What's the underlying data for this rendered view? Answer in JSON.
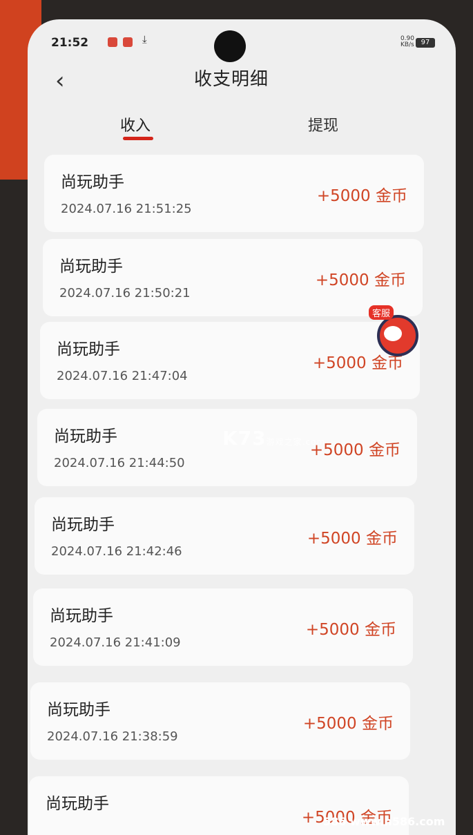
{
  "status_bar": {
    "time": "21:52",
    "network_speed": "0.90",
    "network_unit": "KB/s",
    "battery": "97"
  },
  "header": {
    "back_symbol": "‹",
    "title": "收支明细"
  },
  "tabs": [
    {
      "label": "收入"
    },
    {
      "label": "提现"
    }
  ],
  "records": [
    {
      "name": "尚玩助手",
      "time": "2024.07.16 21:51:25",
      "amount": "+5000 金币"
    },
    {
      "name": "尚玩助手",
      "time": "2024.07.16 21:50:21",
      "amount": "+5000 金币"
    },
    {
      "name": "尚玩助手",
      "time": "2024.07.16 21:47:04",
      "amount": "+5000 金币"
    },
    {
      "name": "尚玩助手",
      "time": "2024.07.16 21:44:50",
      "amount": "+5000 金币"
    },
    {
      "name": "尚玩助手",
      "time": "2024.07.16 21:42:46",
      "amount": "+5000 金币"
    },
    {
      "name": "尚玩助手",
      "time": "2024.07.16 21:41:09",
      "amount": "+5000 金币"
    },
    {
      "name": "尚玩助手",
      "time": "2024.07.16 21:38:59",
      "amount": "+5000 金币"
    },
    {
      "name": "尚玩助手",
      "time": "",
      "amount": "+5000 金币"
    }
  ],
  "customer_service": {
    "label": "客服"
  },
  "watermark": {
    "brand": "K73",
    "sub": "游戏之家",
    "domain": ".com"
  },
  "footer_watermark": "586 www.h586.com"
}
